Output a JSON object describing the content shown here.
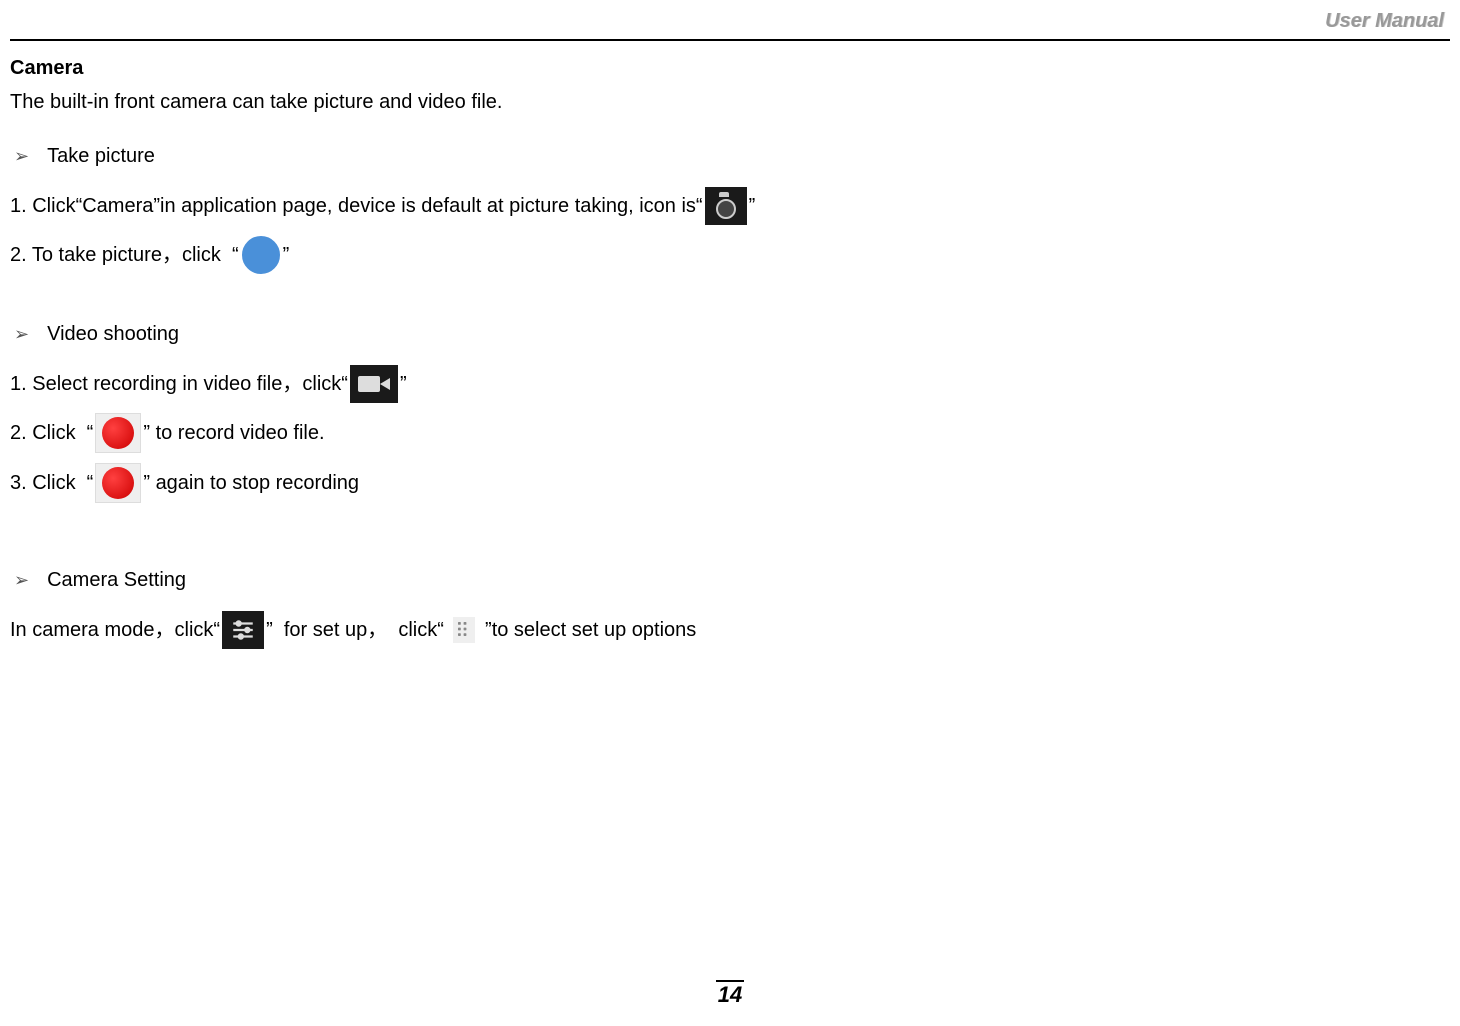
{
  "header": {
    "label": "User Manual"
  },
  "page": {
    "number": "14"
  },
  "section": {
    "title": "Camera",
    "intro": "The built-in front camera can take picture and video file.",
    "take_picture": {
      "bullet": "Take picture",
      "step1_a": "1. Click",
      "step1_b": "“Camera”",
      "step1_c": "in application page, device is default at picture taking, icon is",
      "step1_q1": "“",
      "step1_q2": "”",
      "step2_a": "2. To take picture，click ",
      "step2_q1": " “",
      "step2_q2": "”"
    },
    "video": {
      "bullet": "Video shooting",
      "step1_a": "1. Select recording in video file，click",
      "step1_q1": "“",
      "step1_q2": "”",
      "step2_a": "2. Click ",
      "step2_q1": " “",
      "step2_q2": "” ",
      "step2_b": "to record video file.",
      "step3_a": "3. Click ",
      "step3_q1": " “",
      "step3_q2": "” ",
      "step3_b": "again to stop recording"
    },
    "setting": {
      "bullet": "Camera Setting",
      "line_a": "In camera mode，click",
      "q1": "“",
      "q2": "”",
      "line_b": "  for set up，  click",
      "q3": "“ ",
      "q4": " ”",
      "line_c": "to select set up options"
    }
  }
}
